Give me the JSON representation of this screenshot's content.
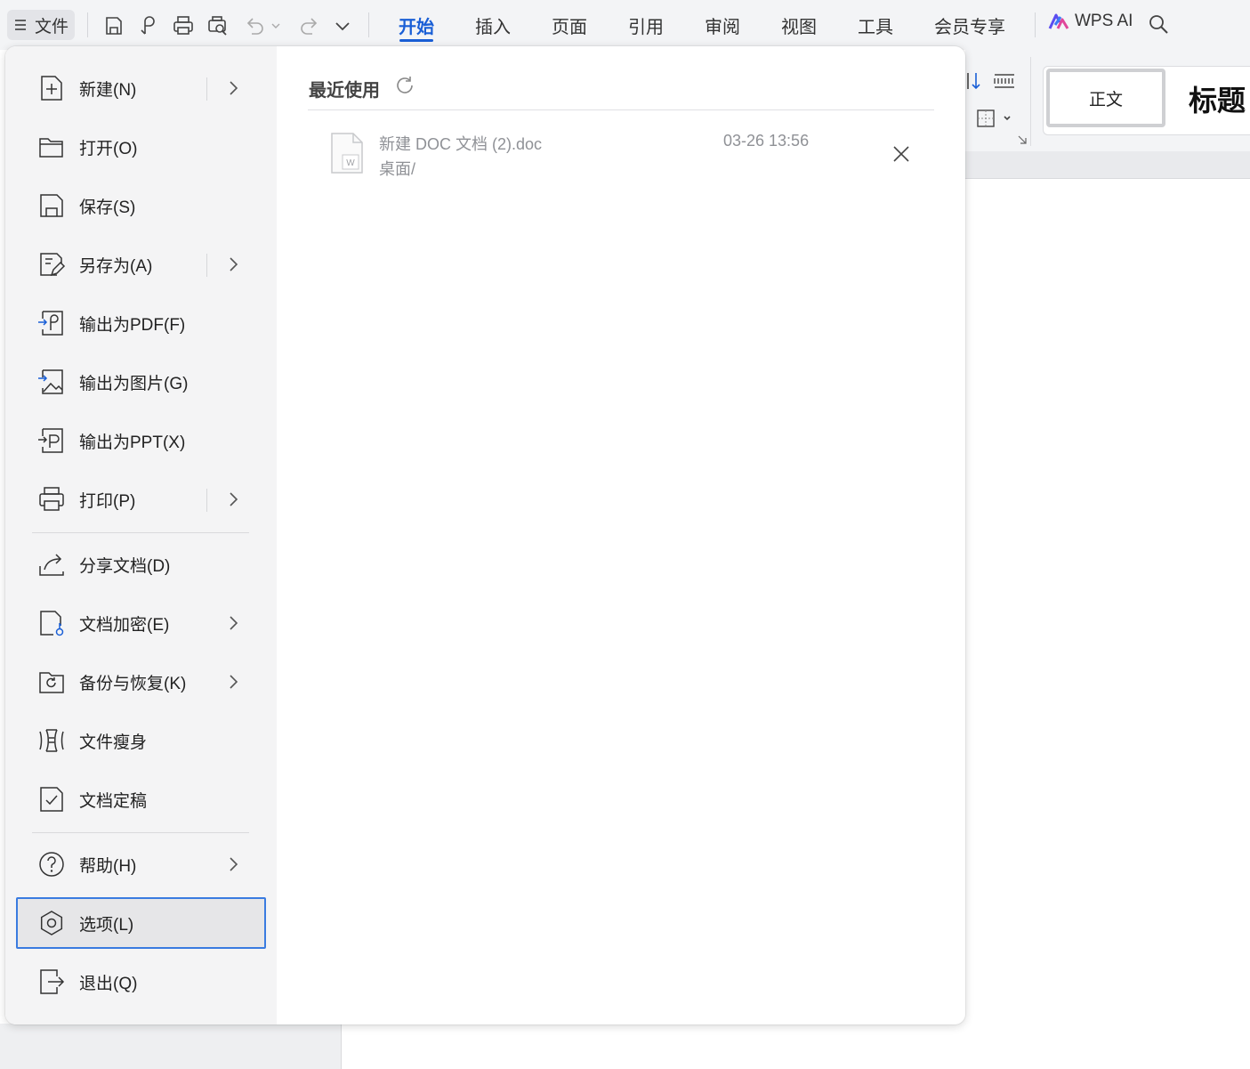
{
  "toolbar": {
    "file_label": "文件",
    "icons": [
      "save-icon",
      "export-pdf-icon",
      "print-icon",
      "print-preview-icon",
      "undo-icon",
      "redo-icon",
      "more-icon"
    ],
    "tabs": [
      {
        "label": "开始",
        "active": true
      },
      {
        "label": "插入",
        "active": false
      },
      {
        "label": "页面",
        "active": false
      },
      {
        "label": "引用",
        "active": false
      },
      {
        "label": "审阅",
        "active": false
      },
      {
        "label": "视图",
        "active": false
      },
      {
        "label": "工具",
        "active": false
      },
      {
        "label": "会员专享",
        "active": false
      }
    ],
    "wps_ai_label": "WPS AI",
    "accent_color": "#1a5fd6"
  },
  "ribbon": {
    "style_normal": "正文",
    "style_heading": "标题"
  },
  "file_menu": {
    "items": [
      {
        "label": "新建(N)",
        "icon": "new-doc-icon",
        "submenu": true
      },
      {
        "label": "打开(O)",
        "icon": "folder-open-icon",
        "submenu": false
      },
      {
        "label": "保存(S)",
        "icon": "save-icon",
        "submenu": false
      },
      {
        "label": "另存为(A)",
        "icon": "save-as-icon",
        "submenu": true
      },
      {
        "label": "输出为PDF(F)",
        "icon": "export-pdf-icon",
        "submenu": false
      },
      {
        "label": "输出为图片(G)",
        "icon": "export-image-icon",
        "submenu": false
      },
      {
        "label": "输出为PPT(X)",
        "icon": "export-ppt-icon",
        "submenu": false
      },
      {
        "label": "打印(P)",
        "icon": "print-icon",
        "submenu": true
      },
      {
        "label": "分享文档(D)",
        "icon": "share-icon",
        "submenu": false
      },
      {
        "label": "文档加密(E)",
        "icon": "encrypt-icon",
        "submenu": true
      },
      {
        "label": "备份与恢复(K)",
        "icon": "backup-icon",
        "submenu": true
      },
      {
        "label": "文件瘦身",
        "icon": "slim-file-icon",
        "submenu": false
      },
      {
        "label": "文档定稿",
        "icon": "finalize-icon",
        "submenu": false
      },
      {
        "label": "帮助(H)",
        "icon": "help-icon",
        "submenu": true
      },
      {
        "label": "选项(L)",
        "icon": "options-icon",
        "submenu": false,
        "selected": true
      },
      {
        "label": "退出(Q)",
        "icon": "exit-icon",
        "submenu": false
      }
    ]
  },
  "recent": {
    "title": "最近使用",
    "files": [
      {
        "name": "新建 DOC 文档 (2).doc",
        "path": "桌面/",
        "time": "03-26 13:56",
        "icon": "word-doc-icon"
      }
    ]
  }
}
